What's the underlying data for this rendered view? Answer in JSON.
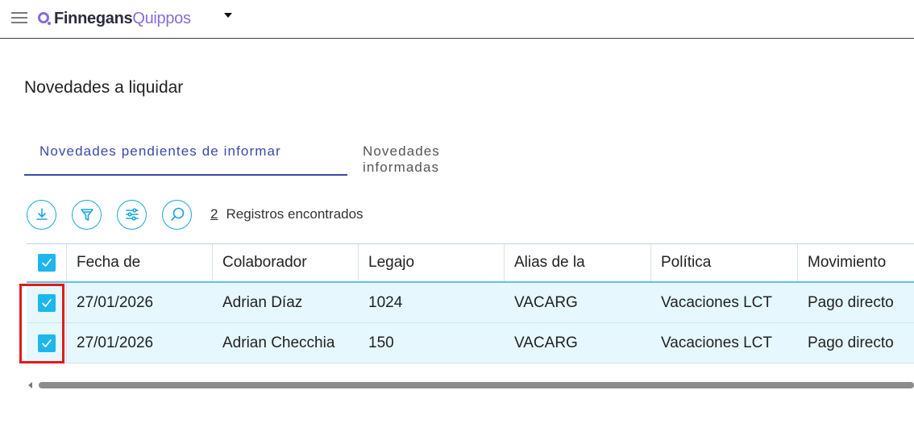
{
  "brand": {
    "part1": "Finnegans",
    "part2": "Quippos"
  },
  "page": {
    "title": "Novedades a liquidar"
  },
  "tabs": [
    {
      "label": "Novedades pendientes de informar",
      "active": true
    },
    {
      "label": "Novedades informadas",
      "active": false
    }
  ],
  "toolbar": {
    "icons": [
      "download-icon",
      "filter-icon",
      "sliders-icon",
      "search-icon"
    ],
    "count": "2",
    "count_label": "Registros encontrados"
  },
  "table": {
    "columns": [
      "Fecha de",
      "Colaborador",
      "Legajo",
      "Alias de la",
      "Política",
      "Movimiento"
    ],
    "rows": [
      {
        "checked": true,
        "cells": [
          "27/01/2026",
          "Adrian Díaz",
          "1024",
          "VACARG",
          "Vacaciones LCT",
          "Pago directo"
        ]
      },
      {
        "checked": true,
        "cells": [
          "27/01/2026",
          "Adrian Checchia",
          "150",
          "VACARG",
          "Vacaciones LCT",
          "Pago directo"
        ]
      }
    ]
  },
  "colors": {
    "accent": "#1fb6ec",
    "tab_active": "#3b4aa8",
    "highlight": "#e21b1b",
    "row_bg": "#e6f8fd",
    "brand_purple": "#8a6bd6"
  }
}
